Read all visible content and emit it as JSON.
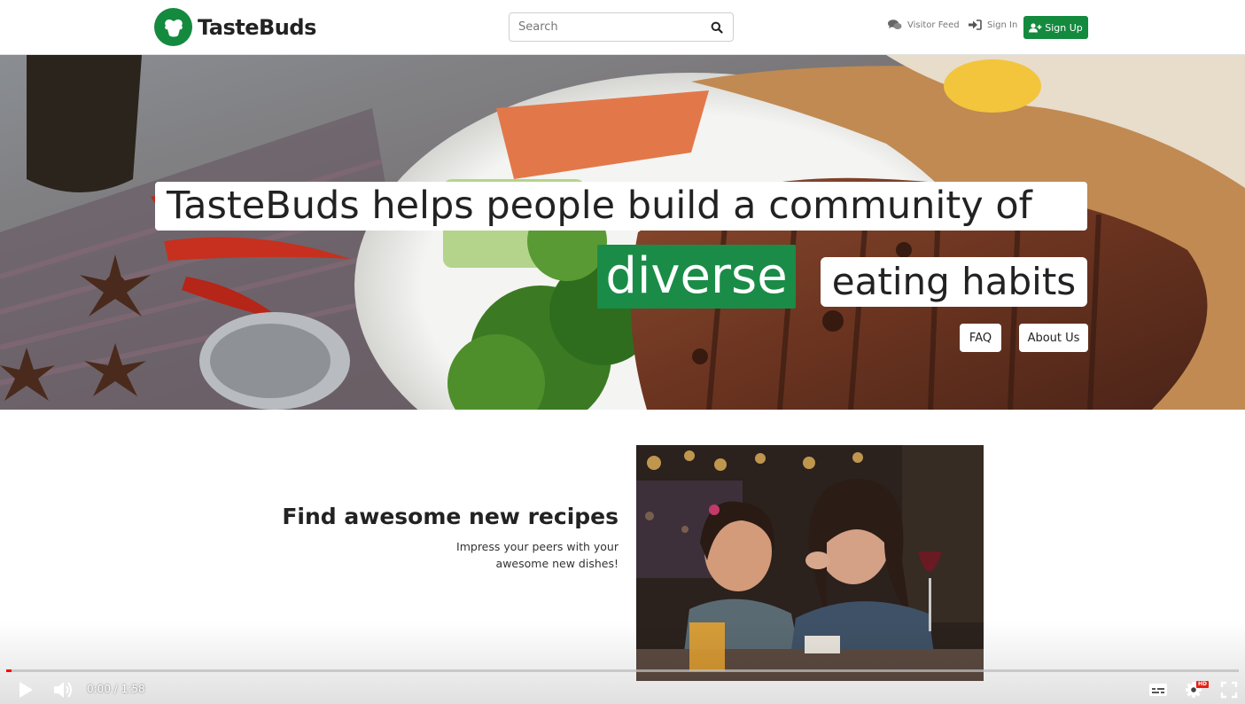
{
  "navbar": {
    "brand": "TasteBuds",
    "search_placeholder": "Search",
    "links": {
      "visitor_feed": "Visitor Feed",
      "sign_in": "Sign In"
    },
    "sign_up": "Sign Up"
  },
  "hero": {
    "headline_line1": "TasteBuds helps people build a community of",
    "headline_highlight": "diverse",
    "headline_line2": "eating habits",
    "buttons": {
      "faq": "FAQ",
      "about": "About Us"
    }
  },
  "feature": {
    "title": "Find awesome new recipes",
    "description_line1": "Impress your peers with your",
    "description_line2": "awesome new dishes!"
  },
  "video": {
    "time_current": "0:00",
    "time_separator": "/",
    "time_total": "1:58",
    "progress": 0.004,
    "hd_badge": "HD"
  },
  "colors": {
    "brand_green": "#148a3f",
    "highlight_green": "#1a8c47",
    "progress_red": "#ff0000"
  }
}
